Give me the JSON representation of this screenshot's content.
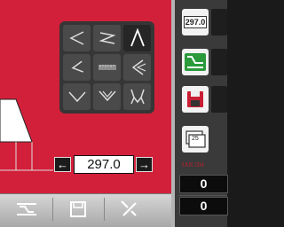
{
  "profile": {
    "value": "297.0"
  },
  "stepper": {
    "decrement_symbol": "←",
    "increment_symbol": "→"
  },
  "tools": [
    {
      "icon": "chevron-left-tool-icon",
      "selected": false
    },
    {
      "icon": "zigzag-tool-icon",
      "selected": false
    },
    {
      "icon": "caret-up-tool-icon",
      "selected": true
    },
    {
      "icon": "z-step-tool-icon",
      "selected": false
    },
    {
      "icon": "ruler-tool-icon",
      "selected": false
    },
    {
      "icon": "double-chevron-left-tool-icon",
      "selected": false
    },
    {
      "icon": "chevron-down-tool-icon",
      "selected": false
    },
    {
      "icon": "double-chevron-down-tool-icon",
      "selected": false
    },
    {
      "icon": "claw-tool-icon",
      "selected": false
    }
  ],
  "bottombar": {
    "buttons": [
      "layer-icon",
      "save-icon",
      "tools-icon"
    ]
  },
  "right_panel": {
    "top_label": "297.0",
    "buttons": [
      "dimension-icon",
      "green-layer-icon",
      "save-icon",
      "counter-icon"
    ],
    "counter_icon_label": "25",
    "ian_label": "IAN 504",
    "counters": [
      "0",
      "0"
    ]
  },
  "colors": {
    "main": "#d3203a",
    "panel": "#363636",
    "accent_green": "#2a9a3a"
  }
}
